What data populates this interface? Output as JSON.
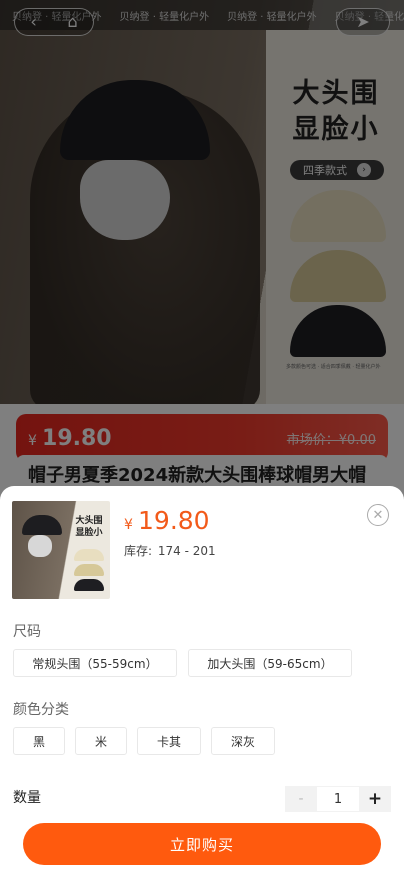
{
  "hero": {
    "brand_marks": [
      "贝纳登 · 轻量化户外",
      "贝纳登 · 轻量化户外",
      "贝纳登 · 轻量化户外",
      "贝纳登 · 轻量化户外"
    ],
    "headline_line1": "大头围",
    "headline_line2": "显脸小",
    "season_tag": "四季款式",
    "season_tag_arrow": "›",
    "caption": "多款颜色可选 · 适合四季佩戴 · 轻量化户外"
  },
  "nav": {
    "back_icon": "‹",
    "home_icon": "⌂",
    "share_icon": "➤"
  },
  "price_banner": {
    "currency": "¥",
    "amount": "19.80",
    "market_price": "市场价：¥0.00"
  },
  "product_title": "帽子男夏季2024新款大头围棒球帽男大帽",
  "sheet": {
    "currency": "¥",
    "price": "19.80",
    "stock_label": "库存:",
    "stock_range": "174 - 201",
    "close_icon": "✕",
    "size_section": {
      "title": "尺码",
      "options": [
        "常规头围（55-59cm）",
        "加大头围（59-65cm）"
      ]
    },
    "color_section": {
      "title": "颜色分类",
      "options": [
        "黑",
        "米",
        "卡其",
        "深灰"
      ]
    },
    "quantity": {
      "label": "数量",
      "minus": "-",
      "value": "1",
      "plus": "+"
    },
    "buy_button": "立即购买"
  },
  "colors": {
    "accent_orange": "#ff5a0e",
    "price_orange": "#f25a1a",
    "banner_red": "#e9271f"
  }
}
